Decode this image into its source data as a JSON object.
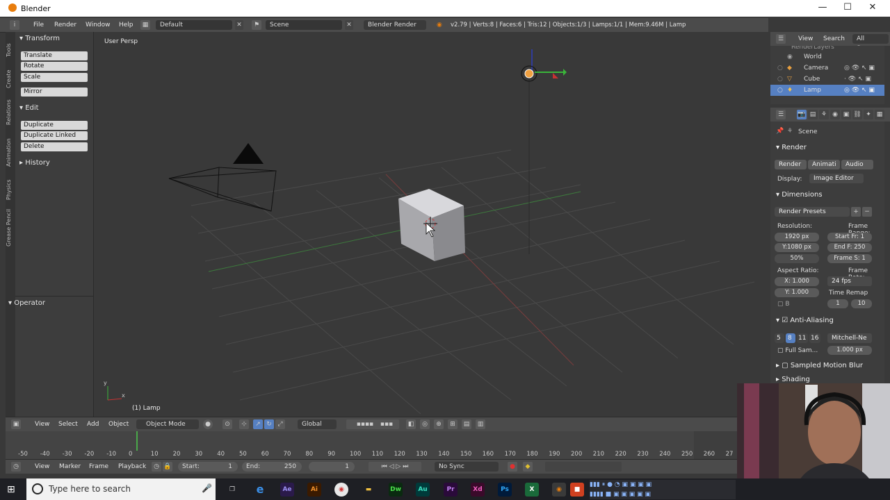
{
  "window": {
    "title": "Blender",
    "controls": [
      "—",
      "☐",
      "✕"
    ]
  },
  "menu": {
    "items": [
      "File",
      "Render",
      "Window",
      "Help"
    ]
  },
  "header": {
    "layout": "Default",
    "scene": "Scene",
    "engine": "Blender Render",
    "stats": "v2.79 | Verts:8 | Faces:6 | Tris:12 | Objects:1/3 | Lamps:1/1 | Mem:9.46M | Lamp"
  },
  "tabs": [
    "Tools",
    "Create",
    "Relations",
    "Animation",
    "Physics",
    "Grease Pencil"
  ],
  "toolshelf": {
    "transform_title": "Transform",
    "transform": [
      "Translate",
      "Rotate",
      "Scale",
      "Mirror"
    ],
    "edit_title": "Edit",
    "edit": [
      "Duplicate",
      "Duplicate Linked",
      "Delete"
    ],
    "history_title": "History",
    "operator_title": "Operator"
  },
  "viewport": {
    "view_label": "User Persp",
    "object_label": "(1) Lamp"
  },
  "vheader": {
    "items": [
      "View",
      "Select",
      "Add",
      "Object"
    ],
    "mode": "Object Mode",
    "orientation": "Global"
  },
  "timeline": {
    "ticks": [
      "-50",
      "-40",
      "-30",
      "-20",
      "-10",
      "0",
      "10",
      "20",
      "30",
      "40",
      "50",
      "60",
      "70",
      "80",
      "90",
      "100",
      "110",
      "120",
      "130",
      "140",
      "150",
      "160",
      "170",
      "180",
      "190",
      "200",
      "210",
      "220",
      "230",
      "240",
      "250",
      "260",
      "27"
    ],
    "menu": [
      "View",
      "Marker",
      "Frame",
      "Playback"
    ],
    "start_label": "Start:",
    "start_value": "1",
    "end_label": "End:",
    "end_value": "250",
    "current": "1",
    "sync": "No Sync"
  },
  "outliner": {
    "view": "View",
    "search": "Search",
    "scenes": "All Scenes",
    "top": "RenderLayers",
    "rows": [
      "World",
      "Camera",
      "Cube",
      "Lamp"
    ]
  },
  "properties": {
    "scene": "Scene",
    "render_title": "Render",
    "render_btns": [
      "Render",
      "Animati",
      "Audio"
    ],
    "display_label": "Display:",
    "display_value": "Image Editor",
    "dimensions_title": "Dimensions",
    "presets": "Render Presets",
    "resolution_label": "Resolution:",
    "res_x": "1920 px",
    "res_y": "Y:1080 px",
    "res_pct": "50%",
    "frame_range_label": "Frame Range:",
    "start_fr": "Start Fr: 1",
    "end_fr": "End F: 250",
    "frame_step": "Frame S: 1",
    "aspect_label": "Aspect Ratio:",
    "asp_x": "X:  1.000",
    "asp_y": "Y:  1.000",
    "frame_rate_label": "Frame Rate:",
    "fps": "24 fps",
    "time_remap": "Time Remap",
    "b_label": "B",
    "remap_old": "1",
    "remap_new": "10",
    "aa_title": "Anti-Aliasing",
    "aa_samples": [
      "5",
      "8",
      "11",
      "16"
    ],
    "aa_filter": "Mitchell-Ne",
    "full_sample": "Full Sam...",
    "filter_size": "1.000 px",
    "motion_blur": "Sampled Motion Blur",
    "shading": "Shading"
  },
  "taskbar": {
    "search_placeholder": "Type here to search",
    "apps": [
      "Ae",
      "Ai",
      "Dw",
      "Au",
      "Pr",
      "Xd",
      "Ps"
    ]
  },
  "colors": {
    "accent": "#5680c2",
    "orange": "#e87d0d",
    "selected_blue": "#5680c2"
  }
}
